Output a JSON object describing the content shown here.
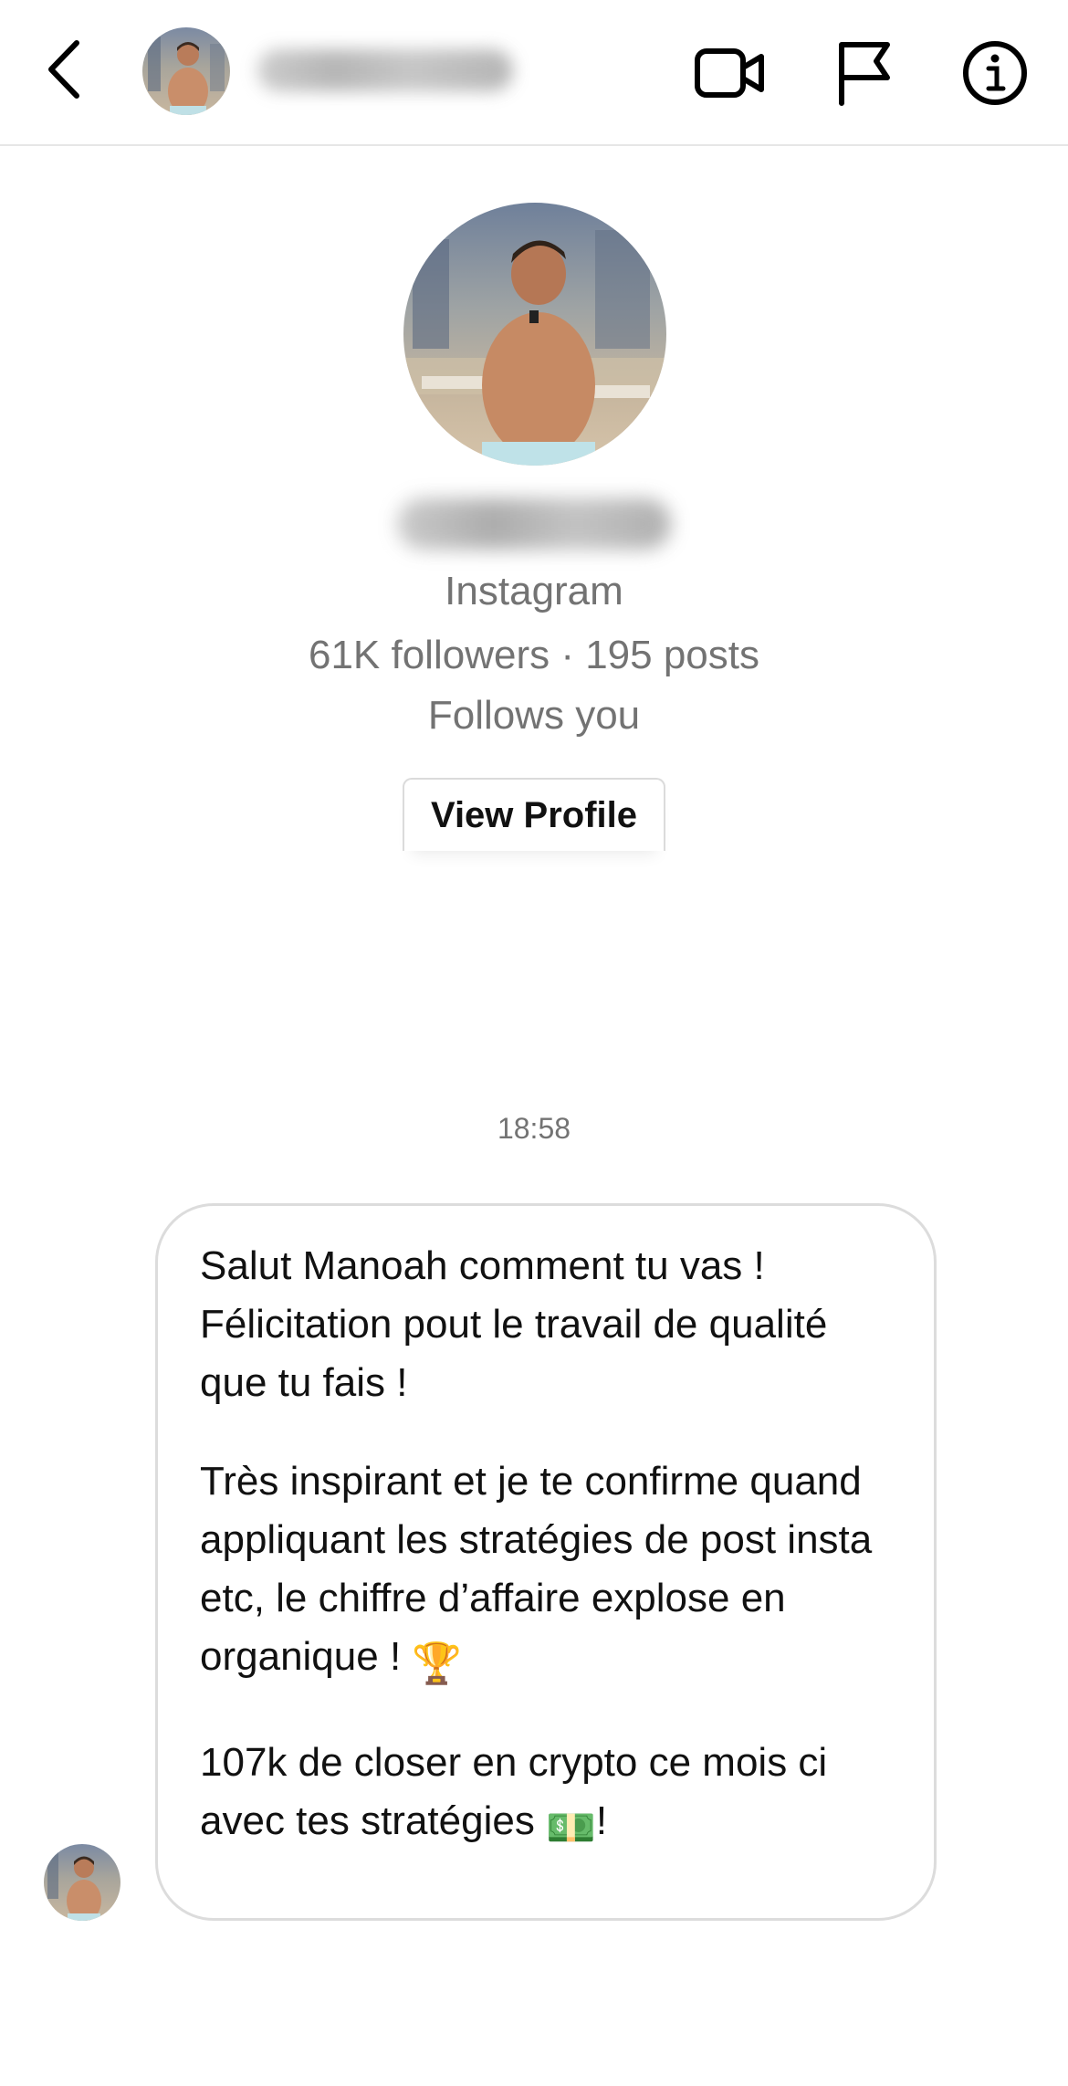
{
  "header": {
    "back_icon": "chevron-left-icon",
    "video_icon": "video-camera-icon",
    "flag_icon": "flag-icon",
    "info_icon": "info-icon"
  },
  "profile": {
    "platform": "Instagram",
    "stats": "61K followers · 195 posts",
    "relationship": "Follows you",
    "view_profile_label": "View Profile"
  },
  "chat": {
    "timestamp": "18:58",
    "message": {
      "paragraph_1": "Salut Manoah comment tu vas ! Félicitation pout le travail de qualité que tu fais !",
      "paragraph_2": "Très inspirant et je te confirme quand appliquant les stratégies de post insta etc, le chiffre d’affaire explose en organique !",
      "paragraph_2_emoji": "🏆",
      "paragraph_3": "107k de closer en crypto ce mois ci avec tes stratégies",
      "paragraph_3_emoji": "💵",
      "paragraph_3_end": "!"
    }
  },
  "colors": {
    "divider": "#e6e6e6",
    "secondary_text": "#737373",
    "bubble_border": "#dcdcdc",
    "button_border": "#dbdbdb"
  }
}
